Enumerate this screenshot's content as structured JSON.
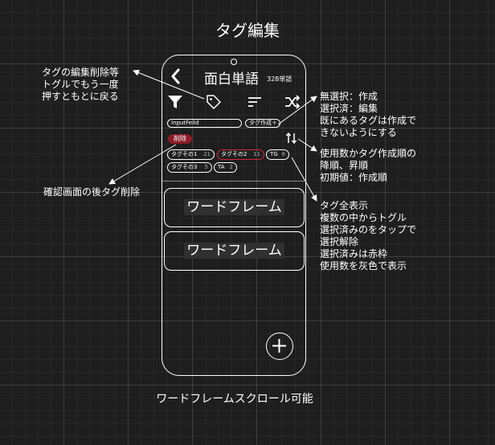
{
  "title": "タグ編集",
  "annotations": {
    "tag_icon_note": "タグの編集削除等\nトグルでもう一度\n押すともとに戻る",
    "create_note": "無選択：作成\n選択済：編集\n既にあるタグは作成で\nきないようにする",
    "sort_note": "使用数かタグ作成順の\n降順、昇順\n初期値：作成順",
    "delete_note": "確認画面の後タグ削除",
    "tags_note": "タグ全表示\n複数の中からトグル\n選択済みのをタップで\n選択解除\n選択済みは赤枠\n使用数を灰色で表示"
  },
  "app": {
    "title": "面白単語",
    "word_count": "328単語",
    "input_placeholder": "InputFeild",
    "create_button": "タグ作成＋",
    "delete_button": "削除",
    "tags": [
      {
        "name": "タグその1",
        "count": "21",
        "selected": false
      },
      {
        "name": "タグその2",
        "count": "11",
        "selected": true
      },
      {
        "name": "TG",
        "count": "8",
        "selected": false
      },
      {
        "name": "タグその3",
        "count": "5",
        "selected": false
      },
      {
        "name": "TA",
        "count": "2",
        "selected": false
      }
    ],
    "cards": [
      "ワードフレーム",
      "ワードフレーム"
    ],
    "accent_color": "#d02a3a",
    "delete_color": "#8a1a26"
  },
  "footer": "ワードフレームスクロール可能"
}
